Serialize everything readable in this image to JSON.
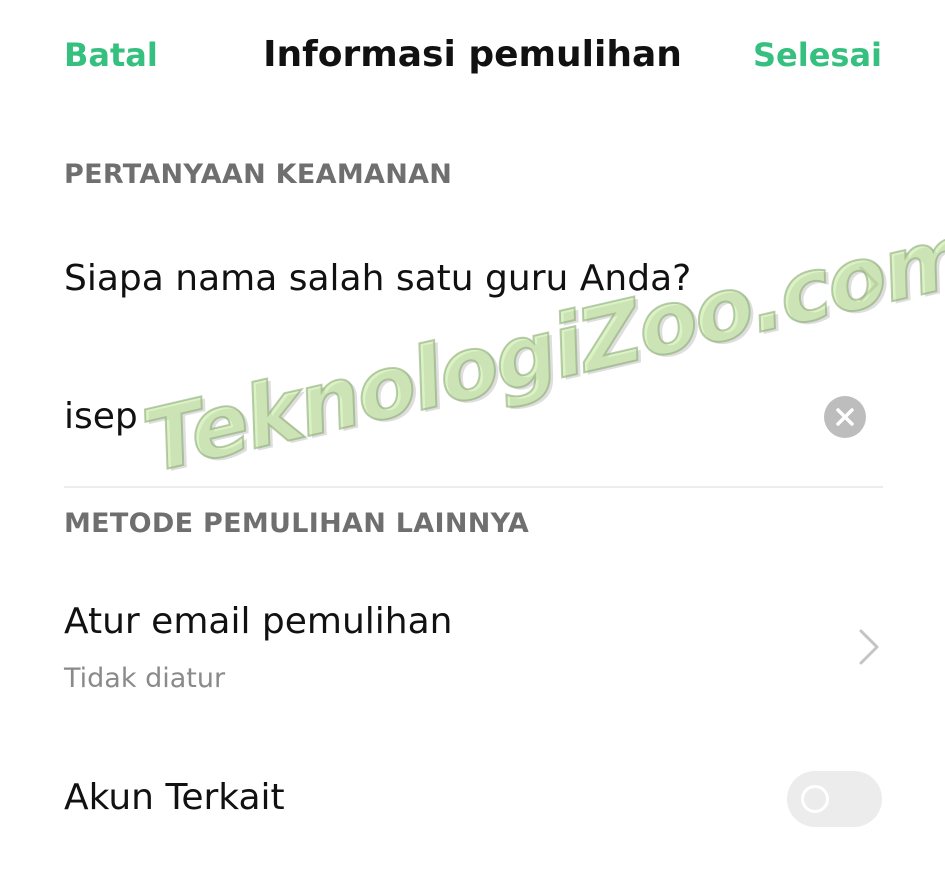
{
  "header": {
    "cancel_label": "Batal",
    "title": "Informasi pemulihan",
    "done_label": "Selesai"
  },
  "security": {
    "section_label": "PERTANYAAN KEAMANAN",
    "question": "Siapa nama salah satu guru Anda?",
    "answer_value": "isep"
  },
  "other_methods": {
    "section_label": "METODE PEMULIHAN LAINNYA",
    "email_title": "Atur email pemulihan",
    "email_status": "Tidak diatur",
    "linked_accounts_label": "Akun Terkait",
    "linked_accounts_enabled": false
  },
  "watermark": {
    "text": "TeknologiZoo.com"
  },
  "colors": {
    "accent": "#36c07f",
    "section_label": "#6f6f6f",
    "subtitle": "#8a8a8a",
    "toggle_off": "#ececec"
  },
  "icons": {
    "security_question_chevron": "chevron-right-icon",
    "email_chevron": "chevron-right-icon",
    "clear_answer": "clear-circle-icon"
  }
}
